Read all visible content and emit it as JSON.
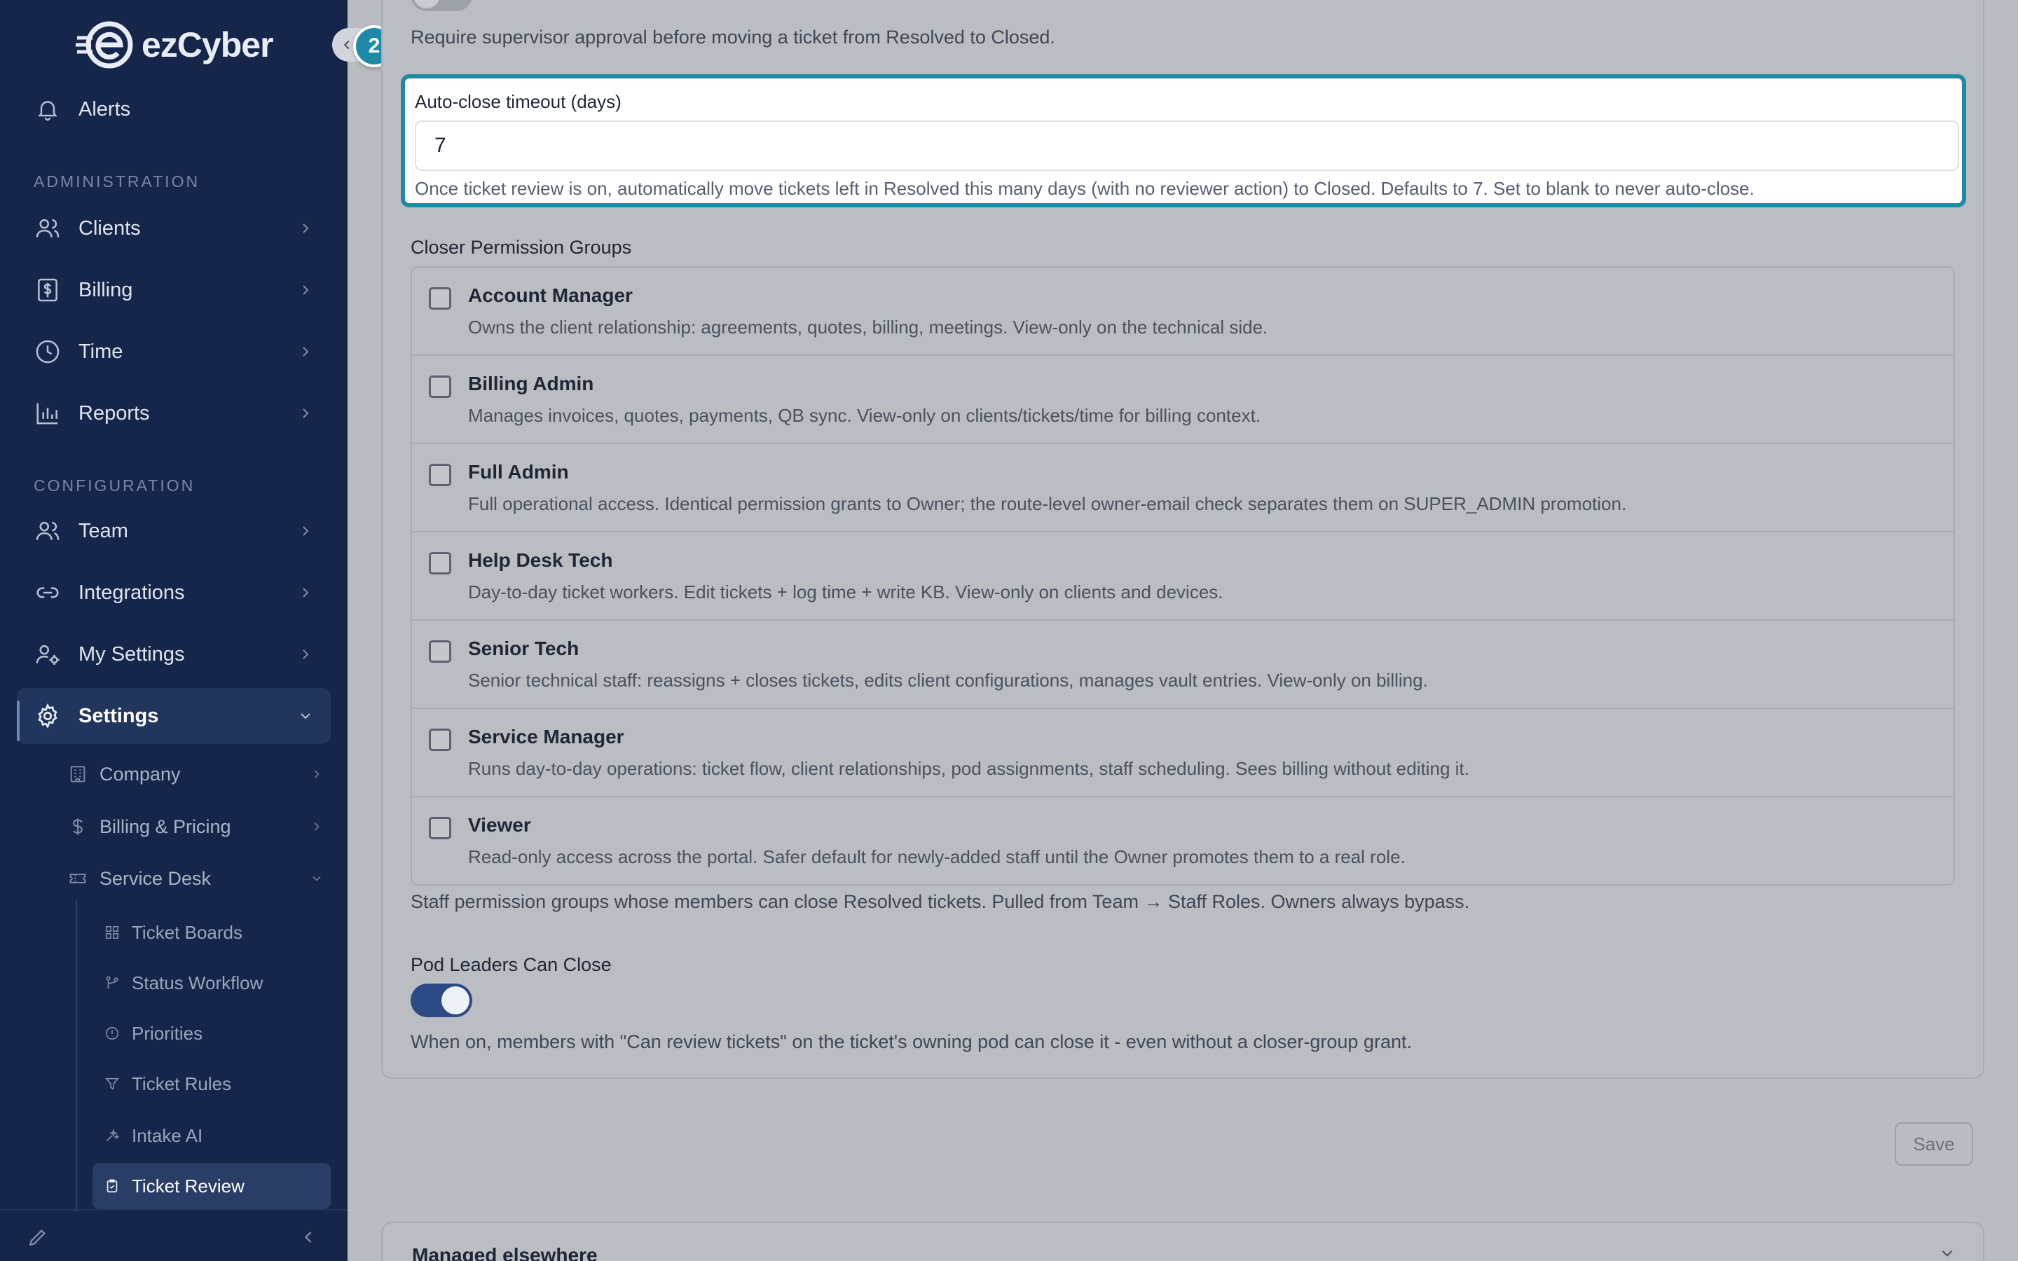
{
  "app": {
    "brand": "ezCyber",
    "accent": "#1e8aa8",
    "sidebar_bg": "#16264a"
  },
  "sidebar": {
    "top_item": {
      "label": "Alerts",
      "icon": "bell-icon"
    },
    "sections": [
      {
        "title": "ADMINISTRATION"
      },
      {
        "title": "CONFIGURATION"
      }
    ],
    "admin_items": [
      {
        "label": "Clients",
        "icon": "users-icon"
      },
      {
        "label": "Billing",
        "icon": "dollar-doc-icon"
      },
      {
        "label": "Time",
        "icon": "clock-icon"
      },
      {
        "label": "Reports",
        "icon": "bar-chart-icon"
      }
    ],
    "config_items": [
      {
        "label": "Team",
        "icon": "users-icon"
      },
      {
        "label": "Integrations",
        "icon": "link-icon"
      },
      {
        "label": "My Settings",
        "icon": "user-gear-icon"
      },
      {
        "label": "Settings",
        "icon": "gear-icon"
      }
    ],
    "settings_sub": [
      {
        "label": "Company",
        "icon": "building-icon"
      },
      {
        "label": "Billing & Pricing",
        "icon": "dollar-icon"
      },
      {
        "label": "Service Desk",
        "icon": "ticket-icon"
      }
    ],
    "service_desk_sub": [
      {
        "label": "Ticket Boards",
        "icon": "grid-icon"
      },
      {
        "label": "Status Workflow",
        "icon": "workflow-icon"
      },
      {
        "label": "Priorities",
        "icon": "alert-circle-icon"
      },
      {
        "label": "Ticket Rules",
        "icon": "filter-icon"
      },
      {
        "label": "Intake AI",
        "icon": "sparkle-icon"
      },
      {
        "label": "Ticket Review",
        "icon": "clipboard-check-icon"
      }
    ]
  },
  "step_badge": "2",
  "settings": {
    "review_help": "Require supervisor approval before moving a ticket from Resolved to Closed.",
    "auto_close": {
      "label": "Auto-close timeout (days)",
      "value": "7",
      "help": "Once ticket review is on, automatically move tickets left in Resolved this many days (with no reviewer action) to Closed. Defaults to 7. Set to blank to never auto-close."
    },
    "closer_groups": {
      "label": "Closer Permission Groups",
      "groups": [
        {
          "name": "Account Manager",
          "desc": "Owns the client relationship: agreements, quotes, billing, meetings. View-only on the technical side.",
          "checked": false
        },
        {
          "name": "Billing Admin",
          "desc": "Manages invoices, quotes, payments, QB sync. View-only on clients/tickets/time for billing context.",
          "checked": false
        },
        {
          "name": "Full Admin",
          "desc": "Full operational access. Identical permission grants to Owner; the route-level owner-email check separates them on SUPER_ADMIN promotion.",
          "checked": false
        },
        {
          "name": "Help Desk Tech",
          "desc": "Day-to-day ticket workers. Edit tickets + log time + write KB. View-only on clients and devices.",
          "checked": false
        },
        {
          "name": "Senior Tech",
          "desc": "Senior technical staff: reassigns + closes tickets, edits client configurations, manages vault entries. View-only on billing.",
          "checked": false
        },
        {
          "name": "Service Manager",
          "desc": "Runs day-to-day operations: ticket flow, client relationships, pod assignments, staff scheduling. Sees billing without editing it.",
          "checked": false
        },
        {
          "name": "Viewer",
          "desc": "Read-only access across the portal. Safer default for newly-added staff until the Owner promotes them to a real role.",
          "checked": false
        }
      ],
      "help": "Staff permission groups whose members can close Resolved tickets. Pulled from Team → Staff Roles. Owners always bypass."
    },
    "pod_leaders": {
      "label": "Pod Leaders Can Close",
      "enabled": true,
      "help": "When on, members with \"Can review tickets\" on the ticket's owning pod can close it - even without a closer-group grant."
    },
    "save_label": "Save"
  },
  "managed_elsewhere": {
    "title": "Managed elsewhere"
  }
}
